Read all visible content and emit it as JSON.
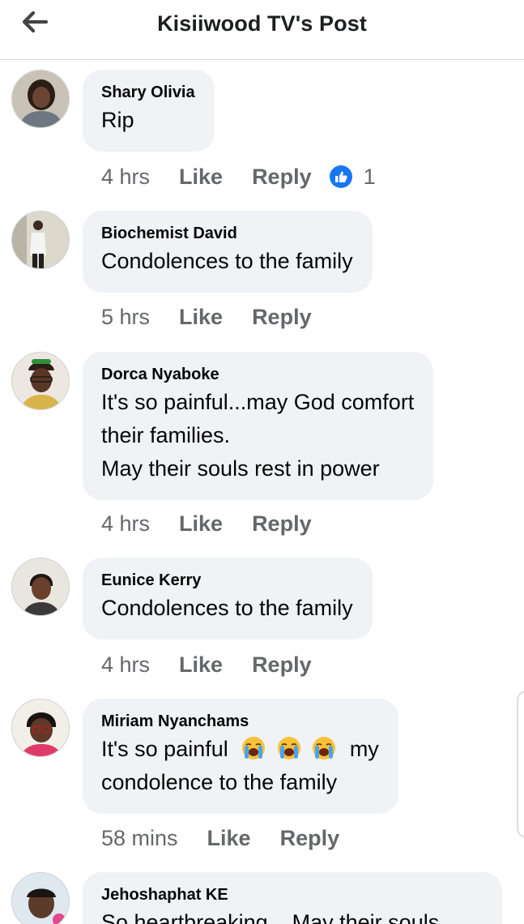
{
  "header": {
    "back_icon": "arrow-left-icon",
    "title": "Kisiiwood TV's Post"
  },
  "comments": [
    {
      "author": "Shary Olivia",
      "text": "Rip",
      "time": "4 hrs",
      "like_label": "Like",
      "reply_label": "Reply",
      "reaction_icon": "thumbs-up-icon",
      "reaction_count": "1"
    },
    {
      "author": "Biochemist David",
      "text": "Condolences to the family",
      "time": "5 hrs",
      "like_label": "Like",
      "reply_label": "Reply"
    },
    {
      "author": "Dorca Nyaboke",
      "text_lines": [
        "It's so painful...may God comfort",
        "their families.",
        "May their souls rest in power"
      ],
      "time": "4 hrs",
      "like_label": "Like",
      "reply_label": "Reply"
    },
    {
      "author": "Eunice Kerry",
      "text": "Condolences to the family",
      "time": "4 hrs",
      "like_label": "Like",
      "reply_label": "Reply"
    },
    {
      "author": "Miriam Nyanchams",
      "text_line1_before": "It's so painful",
      "text_line1_after": "my",
      "text_line2": "condolence to the family",
      "emoji_icon": "loudly-crying-face-icon",
      "time": "58 mins",
      "like_label": "Like",
      "reply_label": "Reply"
    },
    {
      "author": "Jehoshaphat KE",
      "text": "So heartbreaking... May their souls"
    }
  ],
  "colors": {
    "bubble": "#f0f2f5",
    "meta_text": "#65676b",
    "like_badge": "#1877f2"
  }
}
